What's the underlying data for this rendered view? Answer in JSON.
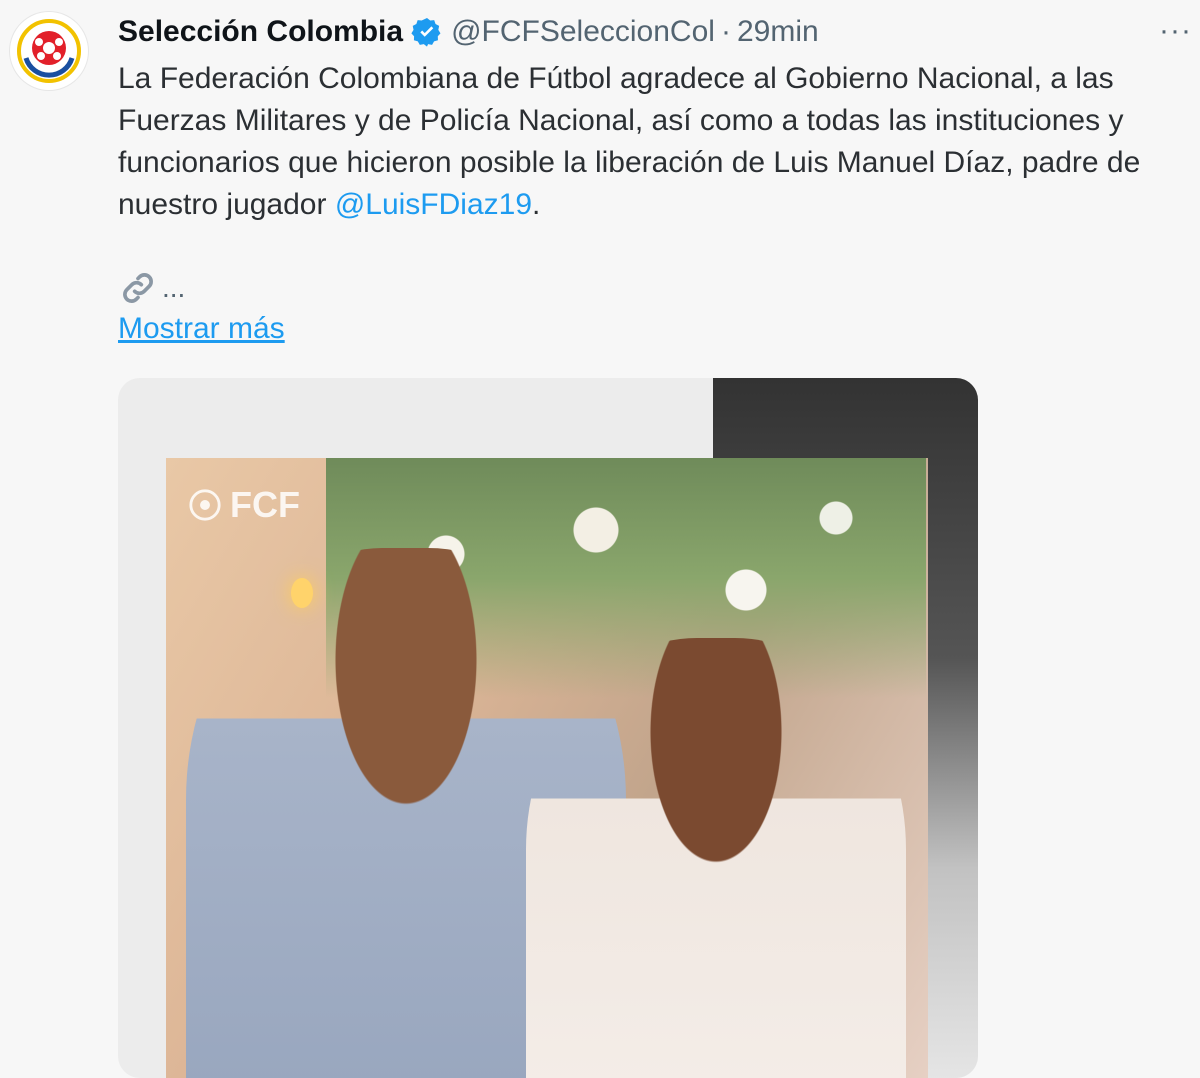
{
  "tweet": {
    "display_name": "Selección Colombia",
    "handle": "@FCFSeleccionCol",
    "separator": "·",
    "time": "29min",
    "more_label": "···",
    "text_main": "La Federación Colombiana de Fútbol agradece al Gobierno Nacional, a las Fuerzas Militares y de Policía Nacional, así como a todas las instituciones y funcionarios que hicieron posible la liberación de Luis Manuel Díaz, padre de nuestro jugador ",
    "mention": "@LuisFDiaz19",
    "text_end": ".",
    "link_ellipsis": "...",
    "show_more": "Mostrar más",
    "media_watermark": "FCF"
  },
  "icons": {
    "verified": "verified-badge-icon",
    "link": "link-icon",
    "avatar": "colombia-federation-crest"
  },
  "colors": {
    "accent": "#1d9bf0",
    "text": "#0f1419",
    "secondary": "#536471",
    "background": "#f7f7f7"
  }
}
